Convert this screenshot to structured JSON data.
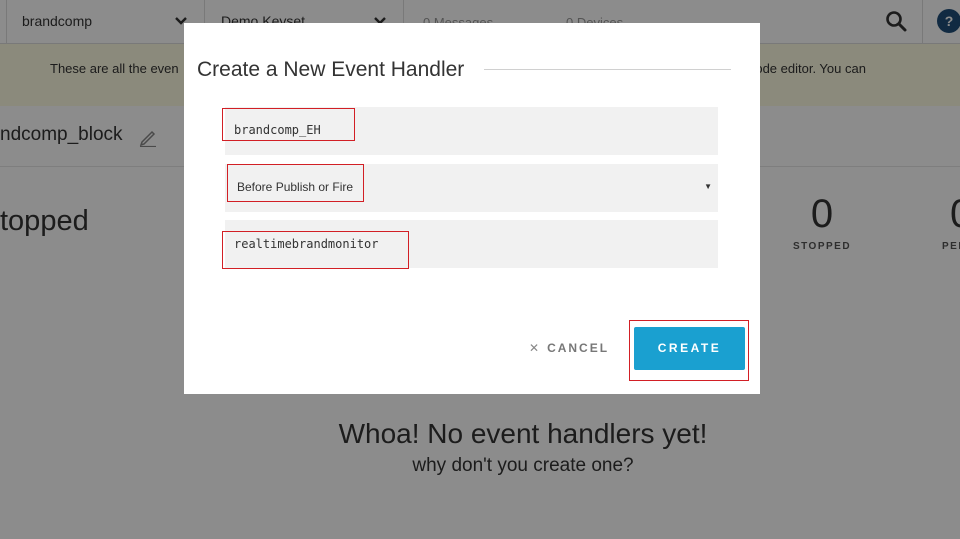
{
  "topbar": {
    "app_select": "brandcomp",
    "keyset_select": "Demo Keyset",
    "messages": "0 Messages",
    "devices": "0 Devices",
    "help": "?"
  },
  "banner": {
    "left_text": "These are all the even",
    "right_text": "e code editor. You can"
  },
  "block": {
    "name": "ndcomp_block",
    "status": "topped",
    "stopped_count": "0",
    "stopped_label": "STOPPED",
    "pending_count": "0",
    "pending_label": "PEN"
  },
  "empty_state": {
    "title": "Whoa! No event handlers yet!",
    "subtitle": "why don't you create one?"
  },
  "modal": {
    "title": "Create a New Event Handler",
    "name_value": "brandcomp_EH",
    "type_value": "Before Publish or Fire",
    "channel_value": "realtimebrandmonitor",
    "cancel_label": "CANCEL",
    "create_label": "CREATE"
  },
  "colors": {
    "accent": "#1aa0d0",
    "highlight": "#d21f25",
    "banner_bg": "#fdfbe2",
    "help_bg": "#1f4e79"
  },
  "icons": [
    "chevron-down-icon",
    "search-icon",
    "help-icon",
    "pencil-icon",
    "close-icon",
    "caret-down-icon"
  ]
}
